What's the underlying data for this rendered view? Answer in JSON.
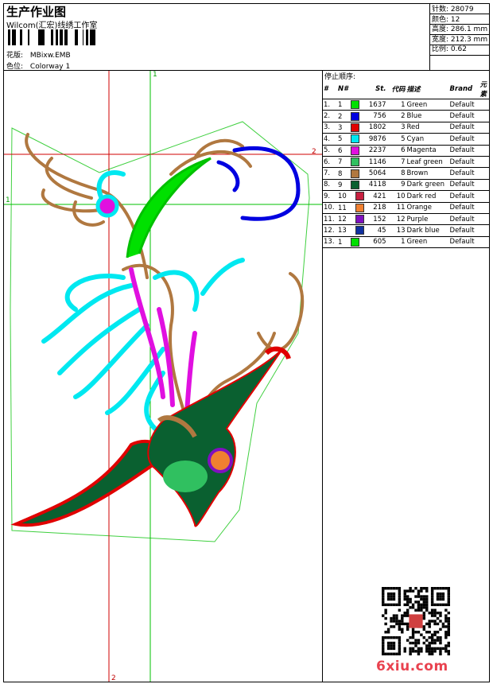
{
  "header": {
    "title": "生产作业图",
    "company": "Wilcom(汇宏)线绣工作室",
    "pattern_label": "花版:",
    "pattern_value": "MBixw.EMB",
    "colorway_label": "色位:",
    "colorway_value": "Colorway 1"
  },
  "stats": [
    {
      "label": "针数:",
      "value": "28079"
    },
    {
      "label": "颜色:",
      "value": "12"
    },
    {
      "label": "高度:",
      "value": "286.1 mm"
    },
    {
      "label": "宽度:",
      "value": "212.3 mm"
    },
    {
      "label": "比例:",
      "value": "0.62"
    }
  ],
  "sequence": {
    "heading": "停止顺序:",
    "columns": [
      "#",
      "N#",
      "St.",
      "代码",
      "描述",
      "Brand",
      "元素"
    ],
    "rows": [
      {
        "n": "1.",
        "nn": "1",
        "color": "#00e000",
        "st": "1637",
        "code": "1",
        "desc": "Green",
        "brand": "Default"
      },
      {
        "n": "2.",
        "nn": "2",
        "color": "#0000e0",
        "st": "756",
        "code": "2",
        "desc": "Blue",
        "brand": "Default"
      },
      {
        "n": "3.",
        "nn": "3",
        "color": "#e00000",
        "st": "1802",
        "code": "3",
        "desc": "Red",
        "brand": "Default"
      },
      {
        "n": "4.",
        "nn": "5",
        "color": "#00e8f0",
        "st": "9876",
        "code": "5",
        "desc": "Cyan",
        "brand": "Default"
      },
      {
        "n": "5.",
        "nn": "6",
        "color": "#e010e0",
        "st": "2237",
        "code": "6",
        "desc": "Magenta",
        "brand": "Default"
      },
      {
        "n": "6.",
        "nn": "7",
        "color": "#30c060",
        "st": "1146",
        "code": "7",
        "desc": "Leaf green",
        "brand": "Default"
      },
      {
        "n": "7.",
        "nn": "8",
        "color": "#b07840",
        "st": "5064",
        "code": "8",
        "desc": "Brown",
        "brand": "Default"
      },
      {
        "n": "8.",
        "nn": "9",
        "color": "#0a6030",
        "st": "4118",
        "code": "9",
        "desc": "Dark green",
        "brand": "Default"
      },
      {
        "n": "9.",
        "nn": "10",
        "color": "#c82040",
        "st": "421",
        "code": "10",
        "desc": "Dark red",
        "brand": "Default"
      },
      {
        "n": "10.",
        "nn": "11",
        "color": "#f08030",
        "st": "218",
        "code": "11",
        "desc": "Orange",
        "brand": "Default"
      },
      {
        "n": "11.",
        "nn": "12",
        "color": "#8010c0",
        "st": "152",
        "code": "12",
        "desc": "Purple",
        "brand": "Default"
      },
      {
        "n": "12.",
        "nn": "13",
        "color": "#1030a0",
        "st": "45",
        "code": "13",
        "desc": "Dark blue",
        "brand": "Default"
      },
      {
        "n": "13.",
        "nn": "1",
        "color": "#00e000",
        "st": "605",
        "code": "1",
        "desc": "Green",
        "brand": "Default"
      }
    ]
  },
  "guides": {
    "h1": "1",
    "h2": "2",
    "v1": "1",
    "v2": "2"
  },
  "watermark": "6xiu.com"
}
